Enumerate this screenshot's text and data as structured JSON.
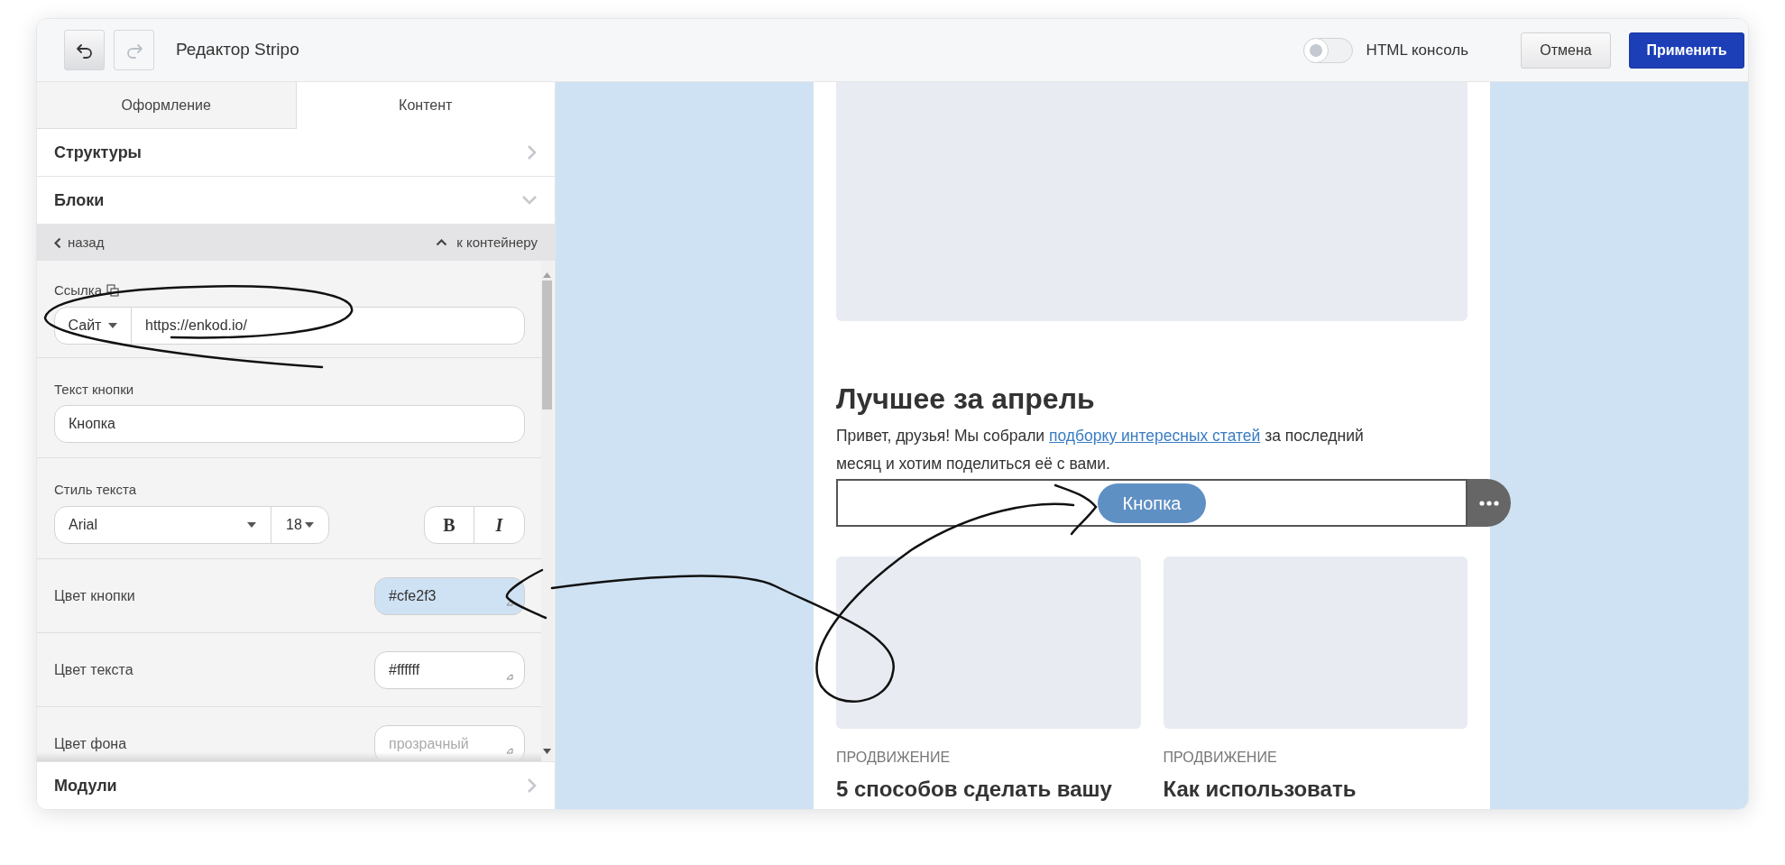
{
  "toolbar": {
    "undo_disabled": false,
    "redo_disabled": true,
    "title": "Редактор Stripo",
    "html_console": {
      "label": "HTML консоль",
      "on": false
    },
    "buttons": [
      {
        "label": "Отмена",
        "kind": "secondary"
      },
      {
        "label": "Применить",
        "kind": "primary"
      }
    ]
  },
  "tabs": [
    {
      "label": "Оформление",
      "selected": false
    },
    {
      "label": "Контент",
      "selected": true
    }
  ],
  "sections_top": [
    {
      "label": "Структуры",
      "expanded": false
    },
    {
      "label": "Блоки",
      "expanded": true
    }
  ],
  "nav": {
    "back": "назад",
    "up": "к контейнеру"
  },
  "form": {
    "link": {
      "label": "Ссылка",
      "type": "Сайт",
      "value": "https://enkod.io/"
    },
    "button_text": {
      "label": "Текст кнопки",
      "value": "Кнопка"
    },
    "text_style": {
      "label": "Стиль текста",
      "font": "Arial",
      "size": "18",
      "bold": "B",
      "italic": "I"
    },
    "colors": [
      {
        "label": "Цвет кнопки",
        "value": "#cfe2f3",
        "color": "#cfe2f3"
      },
      {
        "label": "Цвет текста",
        "value": "#ffffff",
        "color": "#ffffff"
      },
      {
        "label": "Цвет фона",
        "placeholder": "прозрачный"
      }
    ]
  },
  "sections_bottom": [
    {
      "label": "Модули",
      "expanded": false
    }
  ],
  "preview": {
    "heading": "Лучшее за апрель",
    "paragraph": {
      "before": "Привет, друзья! Мы собрали ",
      "link": "подборку интересных статей",
      "after": " за последний месяц и хотим поделиться её с вами."
    },
    "button": "Кнопка",
    "cards": [
      {
        "category": "ПРОДВИЖЕНИЕ",
        "title": "5 способов сделать вашу"
      },
      {
        "category": "ПРОДВИЖЕНИЕ",
        "title": "Как использовать"
      }
    ]
  }
}
